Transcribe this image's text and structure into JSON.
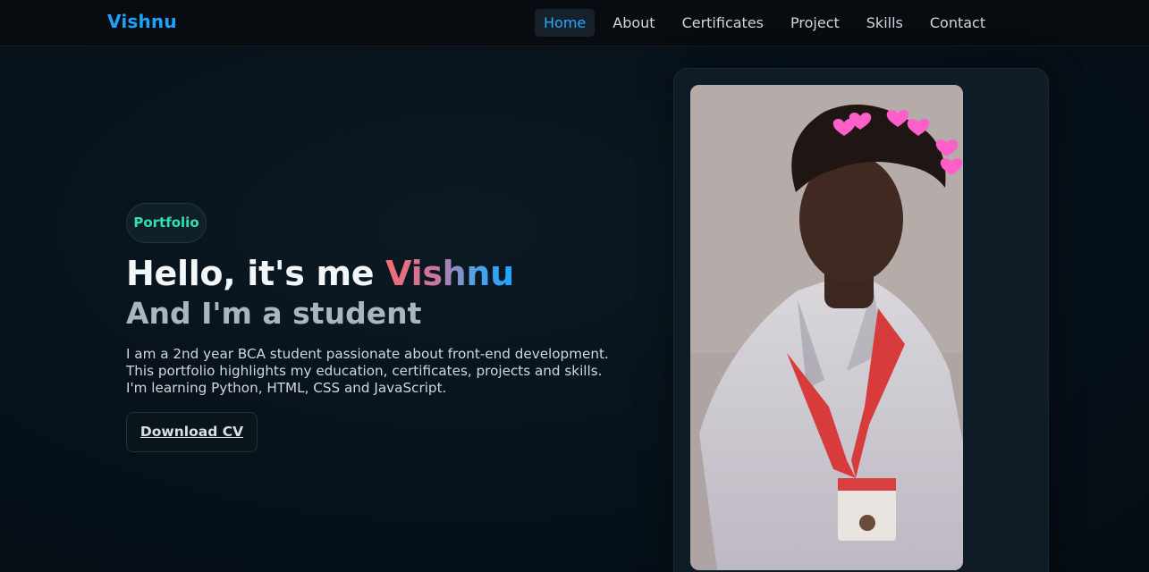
{
  "brand": "Vishnu",
  "nav": {
    "items": [
      {
        "label": "Home",
        "active": true
      },
      {
        "label": "About",
        "active": false
      },
      {
        "label": "Certificates",
        "active": false
      },
      {
        "label": "Project",
        "active": false
      },
      {
        "label": "Skills",
        "active": false
      },
      {
        "label": "Contact",
        "active": false
      }
    ]
  },
  "hero": {
    "badge": "Portfolio",
    "greeting": "Hello, it's me ",
    "name": "Vishnu",
    "role": "And I'm a student",
    "description": "I am a 2nd year BCA student passionate about front-end development. This portfolio highlights my education, certificates, projects and skills. I'm learning Python, HTML, CSS and JavaScript.",
    "cv_button": "Download CV"
  },
  "colors": {
    "accent": "#1aa3ff",
    "badge_text": "#2ee0b6",
    "background": "#07121b"
  }
}
